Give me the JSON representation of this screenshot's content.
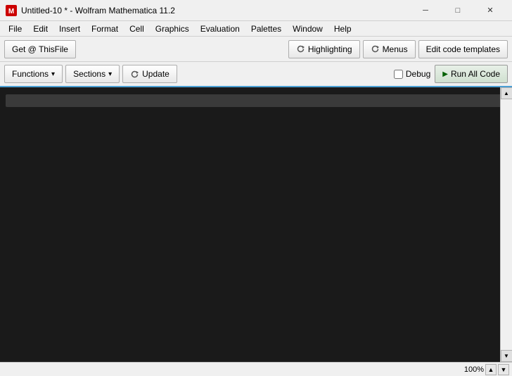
{
  "titleBar": {
    "icon": "mathematica-icon",
    "title": "Untitled-10 * - Wolfram Mathematica 11.2",
    "minimizeLabel": "─",
    "maximizeLabel": "□",
    "closeLabel": "✕"
  },
  "menuBar": {
    "items": [
      {
        "id": "file",
        "label": "File"
      },
      {
        "id": "edit",
        "label": "Edit"
      },
      {
        "id": "insert",
        "label": "Insert"
      },
      {
        "id": "format",
        "label": "Format"
      },
      {
        "id": "cell",
        "label": "Cell"
      },
      {
        "id": "graphics",
        "label": "Graphics"
      },
      {
        "id": "evaluation",
        "label": "Evaluation"
      },
      {
        "id": "palettes",
        "label": "Palettes"
      },
      {
        "id": "window",
        "label": "Window"
      },
      {
        "id": "help",
        "label": "Help"
      }
    ]
  },
  "toolbar1": {
    "getThisFileLabel": "Get @ ThisFile",
    "highlightingLabel": "Highlighting",
    "menusLabel": "Menus",
    "editCodeTemplatesLabel": "Edit code templates"
  },
  "toolbar2": {
    "functionsLabel": "Functions",
    "sectionsLabel": "Sections",
    "updateLabel": "Update",
    "debugLabel": "Debug",
    "runAllCodeLabel": "Run All Code"
  },
  "statusBar": {
    "zoomLevel": "100%",
    "upArrow": "▲",
    "downArrow": "▼"
  }
}
